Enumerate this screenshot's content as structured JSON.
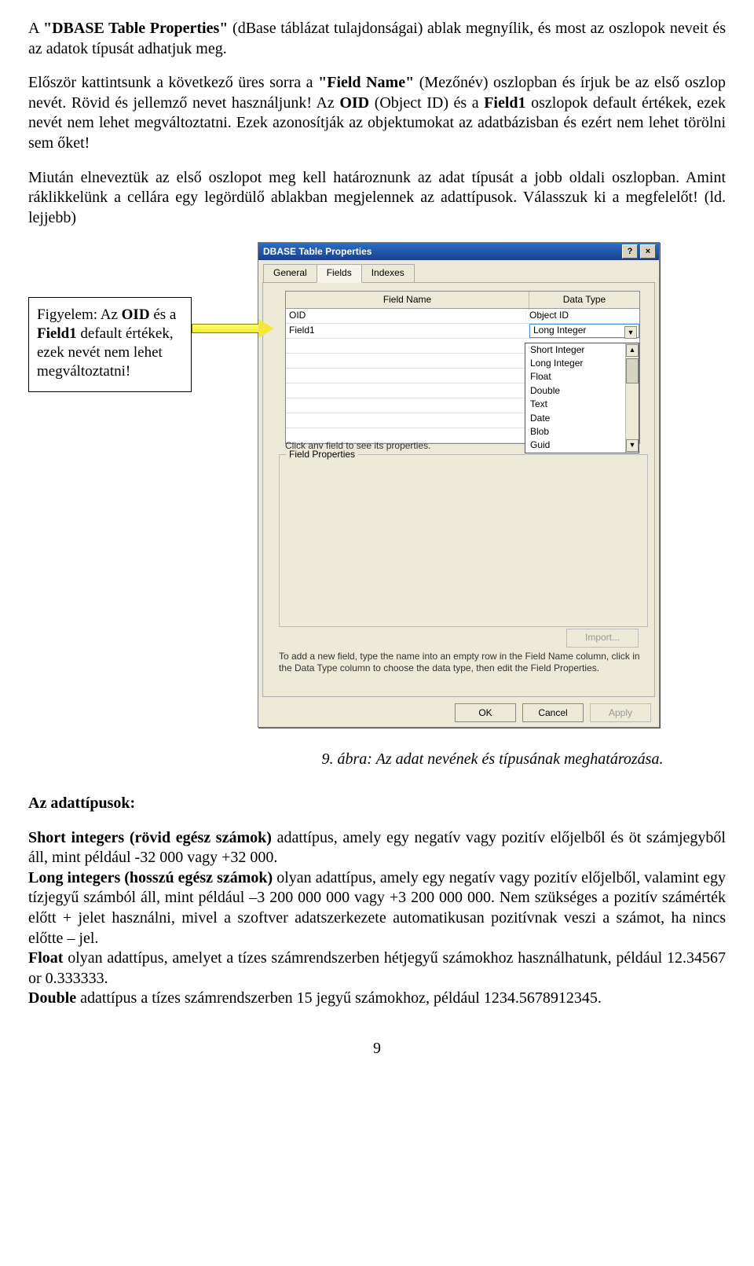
{
  "p1_a": "A ",
  "p1_b": "\"DBASE Table Properties\"",
  "p1_c": " (dBase táblázat tulajdonságai) ablak megnyílik, és most az oszlopok neveit és az adatok típusát adhatjuk meg.",
  "p2_a": "Először kattintsunk a következő üres sorra a ",
  "p2_b": "\"Field Name\"",
  "p2_c": " (Mezőnév) oszlopban és írjuk be az első oszlop nevét. Rövid és jellemző nevet használjunk! Az ",
  "p2_d": "OID",
  "p2_e": " (Object ID) és a ",
  "p2_f": "Field1",
  "p2_g": " oszlopok default értékek, ezek nevét nem lehet megváltoztatni. Ezek azonosítják az objektumokat az adatbázisban és ezért nem lehet törölni sem őket!",
  "p3": "Miután elneveztük az első oszlopot meg kell határoznunk az adat típusát a jobb oldali oszlopban. Amint ráklikkelünk a cellára egy legördülő ablakban megjelennek az adattípusok. Válasszuk ki a megfelelőt! (ld. lejjebb)",
  "callout_a": "Figyelem: Az ",
  "callout_b": "OID",
  "callout_c": " és a ",
  "callout_d": "Field1",
  "callout_e": " default értékek, ezek nevét nem lehet megváltoztatni!",
  "dialog": {
    "title": "DBASE Table Properties",
    "help": "?",
    "close": "×",
    "tabs": {
      "general": "General",
      "fields": "Fields",
      "indexes": "Indexes"
    },
    "grid": {
      "h1": "Field Name",
      "h2": "Data Type",
      "rows": [
        {
          "name": "OID",
          "type": "Object ID"
        },
        {
          "name": "Field1",
          "type": "Long Integer"
        }
      ]
    },
    "dropdown": [
      "Short Integer",
      "Long Integer",
      "Float",
      "Double",
      "Text",
      "Date",
      "Blob",
      "Guid"
    ],
    "hint": "Click any field to see its properties.",
    "fp_title": "Field Properties",
    "import": "Import...",
    "footer": "To add a new field, type the name into an empty row in the Field Name column, click in the Data Type column to choose the data type, then edit the Field Properties.",
    "ok": "OK",
    "cancel": "Cancel",
    "apply": "Apply"
  },
  "caption": "9. ábra: Az adat nevének és típusának meghatározása.",
  "section": "Az adattípusok:",
  "dt": {
    "a1": "Short integers (rövid egész számok)",
    "a2": " adattípus, amely egy negatív vagy pozitív előjelből és öt számjegyből áll, mint például -32 000 vagy +32 000.",
    "b1": "Long integers (hosszú egész számok)",
    "b2": " olyan adattípus, amely egy negatív vagy pozitív előjelből, valamint egy tízjegyű számból áll, mint például –3 200 000 000 vagy +3 200 000 000. Nem szükséges a pozitív számérték előtt + jelet használni, mivel a szoftver adatszerkezete automatikusan pozitívnak veszi a számot, ha nincs előtte – jel.",
    "c1": "Float",
    "c2": " olyan adattípus, amelyet a tízes számrendszerben hétjegyű számokhoz használhatunk, például 12.34567 or 0.333333.",
    "d1": "Double",
    "d2": " adattípus a tízes számrendszerben 15 jegyű számokhoz, például 1234.5678912345."
  },
  "pagenum": "9"
}
